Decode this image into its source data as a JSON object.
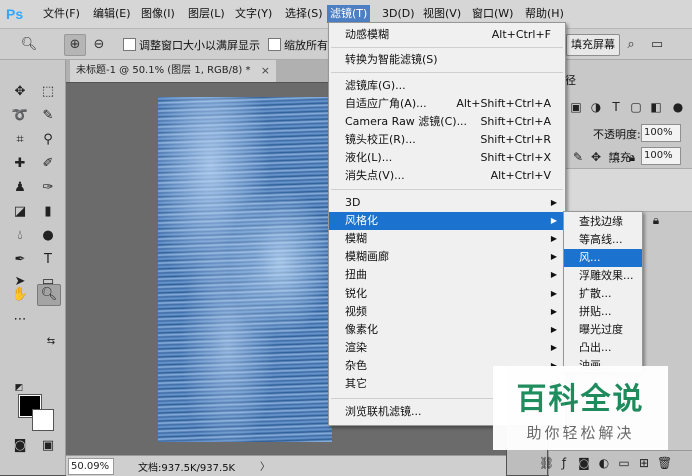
{
  "app": {
    "logo": "Ps"
  },
  "menubar": {
    "items": [
      "文件(F)",
      "编辑(E)",
      "图像(I)",
      "图层(L)",
      "文字(Y)",
      "选择(S)",
      "滤镜(T)",
      "3D(D)",
      "视图(V)",
      "窗口(W)",
      "帮助(H)"
    ],
    "active": "滤镜(T)"
  },
  "options": {
    "resize_label": "调整窗口大小以满屏显示",
    "zoom_all_label": "缩放所有窗",
    "fill_screen_label": "填充屏幕"
  },
  "document": {
    "tab_title": "未标题-1 @ 50.1% (图层 1, RGB/8) *",
    "close_glyph": "×",
    "zoom_value": "50.09%",
    "doc_info": "文档:937.5K/937.5K",
    "status_arrow": "〉"
  },
  "layers_panel": {
    "tab_fragment": "径",
    "opacity_label": "不透明度:",
    "opacity_value": "100%",
    "fill_label": "填充:",
    "fill_value": "100%"
  },
  "filter_menu": {
    "group1": [
      {
        "label": "动感模糊",
        "shortcut": "Alt+Ctrl+F"
      }
    ],
    "group2": [
      {
        "label": "转换为智能滤镜(S)",
        "shortcut": ""
      }
    ],
    "group3": [
      {
        "label": "滤镜库(G)...",
        "shortcut": ""
      },
      {
        "label": "自适应广角(A)...",
        "shortcut": "Alt+Shift+Ctrl+A"
      },
      {
        "label": "Camera Raw 滤镜(C)...",
        "shortcut": "Shift+Ctrl+A"
      },
      {
        "label": "镜头校正(R)...",
        "shortcut": "Shift+Ctrl+R"
      },
      {
        "label": "液化(L)...",
        "shortcut": "Shift+Ctrl+X"
      },
      {
        "label": "消失点(V)...",
        "shortcut": "Alt+Ctrl+V"
      }
    ],
    "group4": [
      "3D",
      "风格化",
      "模糊",
      "模糊画廊",
      "扭曲",
      "锐化",
      "视频",
      "像素化",
      "渲染",
      "杂色",
      "其它"
    ],
    "highlighted": "风格化",
    "group5": [
      {
        "label": "浏览联机滤镜...",
        "shortcut": ""
      }
    ]
  },
  "stylize_submenu": {
    "items": [
      "查找边缘",
      "等高线...",
      "风...",
      "浮雕效果...",
      "扩散...",
      "拼贴...",
      "曝光过度",
      "凸出...",
      "油画..."
    ],
    "highlighted": "风..."
  },
  "watermark": {
    "logo": "百科全说",
    "sub": "助你轻松解决"
  },
  "colors": {
    "menu_highlight": "#1c73cf",
    "watermark_green": "#1a8a5a"
  }
}
